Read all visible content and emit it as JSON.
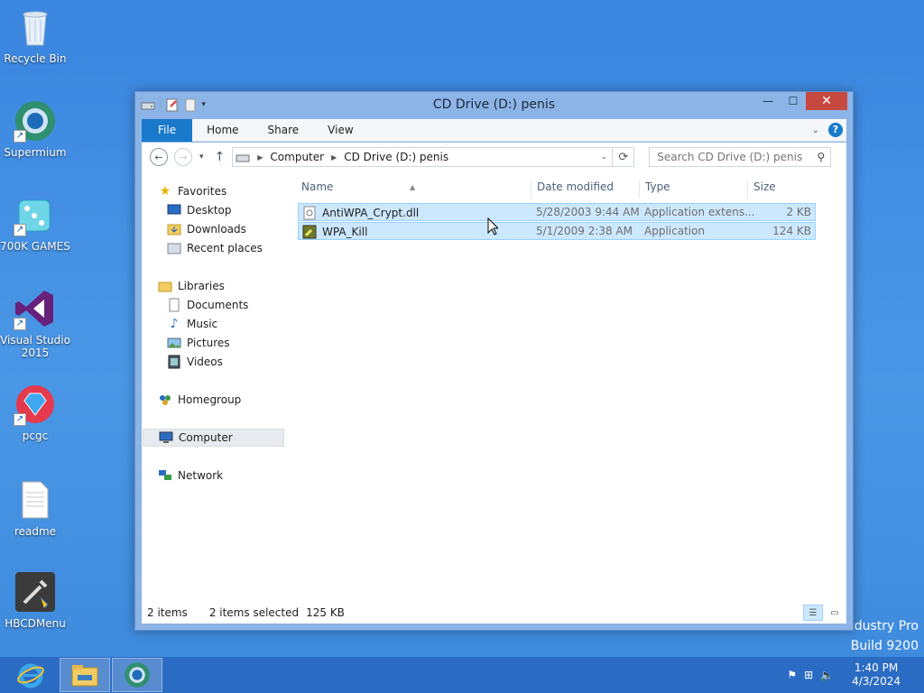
{
  "desktop": {
    "icons": [
      {
        "label": "Recycle Bin"
      },
      {
        "label": "Supermium"
      },
      {
        "label": "700K GAMES"
      },
      {
        "label": "Visual Studio 2015"
      },
      {
        "label": "pcgc"
      },
      {
        "label": "readme"
      },
      {
        "label": "HBCDMenu"
      }
    ],
    "watermark_line1": "ndustry Pro",
    "watermark_line2": "Build 9200"
  },
  "window": {
    "title": "CD Drive (D:) penis",
    "ribbon_tabs": [
      "File",
      "Home",
      "Share",
      "View"
    ],
    "address": {
      "segments": [
        "Computer",
        "CD Drive (D:) penis"
      ]
    },
    "search": {
      "placeholder": "Search CD Drive (D:) penis"
    },
    "nav": {
      "favorites": "Favorites",
      "desktop": "Desktop",
      "downloads": "Downloads",
      "recent": "Recent places",
      "libraries": "Libraries",
      "documents": "Documents",
      "music": "Music",
      "pictures": "Pictures",
      "videos": "Videos",
      "homegroup": "Homegroup",
      "computer": "Computer",
      "network": "Network"
    },
    "columns": {
      "name": "Name",
      "date": "Date modified",
      "type": "Type",
      "size": "Size"
    },
    "files": [
      {
        "name": "AntiWPA_Crypt.dll",
        "date": "5/28/2003 9:44 AM",
        "type": "Application extens...",
        "size": "2 KB",
        "icon": "dll-file-icon"
      },
      {
        "name": "WPA_Kill",
        "date": "5/1/2009 2:38 AM",
        "type": "Application",
        "size": "124 KB",
        "icon": "application-icon"
      }
    ],
    "status": {
      "items": "2 items",
      "selected": "2 items selected",
      "size": "125 KB"
    }
  },
  "taskbar": {
    "time": "1:40 PM",
    "date": "4/3/2024"
  },
  "colors": {
    "accent": "#1979ca",
    "selection": "#cce8ff",
    "close": "#c7483e"
  }
}
